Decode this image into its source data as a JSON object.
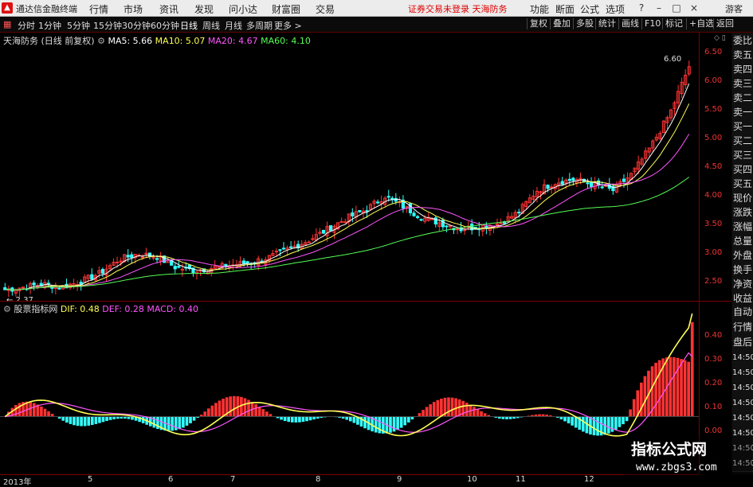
{
  "titlebar": {
    "app_name": "通达信金融终端",
    "menus": [
      "行情",
      "市场",
      "资讯",
      "发现",
      "问小达",
      "财富圈",
      "交易"
    ],
    "notice": "证券交易未登录  天海防务",
    "right_menus": [
      "功能",
      "断面",
      "公式",
      "选项"
    ],
    "guest": "游客"
  },
  "toolbar": {
    "periods": [
      "分时",
      "1分钟",
      "5分钟",
      "15分钟",
      "30分钟",
      "60分钟",
      "日线",
      "周线",
      "月线",
      "多周期",
      "更多 >"
    ],
    "active_period": "日线",
    "right_buttons": [
      "复权",
      "叠加",
      "多股",
      "统计",
      "画线",
      "F10",
      "标记",
      "+自选",
      "返回"
    ]
  },
  "main_chart": {
    "legend_title": "天海防务 (日线 前复权)",
    "ma": [
      {
        "label": "MA5: 5.66",
        "color": "#ffffff"
      },
      {
        "label": "MA10: 5.07",
        "color": "#ffff55"
      },
      {
        "label": "MA20: 4.67",
        "color": "#ff55ff"
      },
      {
        "label": "MA60: 4.10",
        "color": "#55ff55"
      }
    ],
    "y_labels": [
      "6.50",
      "6.00",
      "5.50",
      "5.00",
      "4.50",
      "4.00",
      "3.50",
      "3.00",
      "2.50"
    ],
    "high_label": "6.60",
    "low_label": "2.37"
  },
  "macd_chart": {
    "legend_title": "股票指标网",
    "dif": "DIF: 0.48",
    "dea": "DEF: 0.28",
    "macd": "MACD: 0.40",
    "y_labels": [
      "0.40",
      "0.30",
      "0.20",
      "0.10",
      "0.00"
    ]
  },
  "x_axis": {
    "dates": [
      "2013年",
      "5",
      "6",
      "7",
      "8",
      "9",
      "10",
      "11",
      "12"
    ]
  },
  "side_panel": {
    "quote_labels": [
      "委比",
      "卖五",
      "卖四",
      "卖三",
      "卖二",
      "卖一",
      "买一",
      "买二",
      "买三",
      "买四",
      "买五",
      "现价",
      "涨跌",
      "涨幅",
      "总量",
      "外盘",
      "换手",
      "净资",
      "收益"
    ],
    "macd_labels": [
      "自动",
      "行情",
      "盘后",
      "14:50",
      "14:50",
      "14:50",
      "14:50",
      "14:50",
      "14:50",
      "14:50",
      "14:50"
    ]
  },
  "watermark": {
    "line1": "指标公式网",
    "line2": "www.zbgs3.com"
  },
  "colors": {
    "up": "#ff3333",
    "down": "#33ffff",
    "axis_border": "#7a0000",
    "ma5": "#ffffff",
    "ma10": "#ffff55",
    "ma20": "#ff55ff",
    "ma60": "#55ff55",
    "dif": "#ffff55",
    "dea": "#ff55ff"
  },
  "chart_data": {
    "type": "candlestick",
    "title": "天海防务 (日线 前复权)",
    "ylim": [
      2.3,
      6.8
    ],
    "close_approx": [
      2.4,
      2.45,
      2.5,
      2.45,
      2.55,
      2.7,
      2.95,
      3.05,
      3.0,
      2.8,
      2.75,
      2.8,
      2.85,
      2.9,
      3.0,
      3.15,
      3.3,
      3.5,
      3.7,
      3.85,
      4.1,
      3.9,
      3.7,
      3.6,
      3.5,
      3.55,
      3.6,
      3.8,
      4.2,
      4.35,
      4.4,
      4.3,
      4.2,
      4.5,
      5.0,
      5.6,
      6.45
    ],
    "macd_ylim": [
      -0.25,
      0.48
    ],
    "dif_end": 0.48,
    "dea_end": 0.28,
    "macd_end": 0.4
  }
}
